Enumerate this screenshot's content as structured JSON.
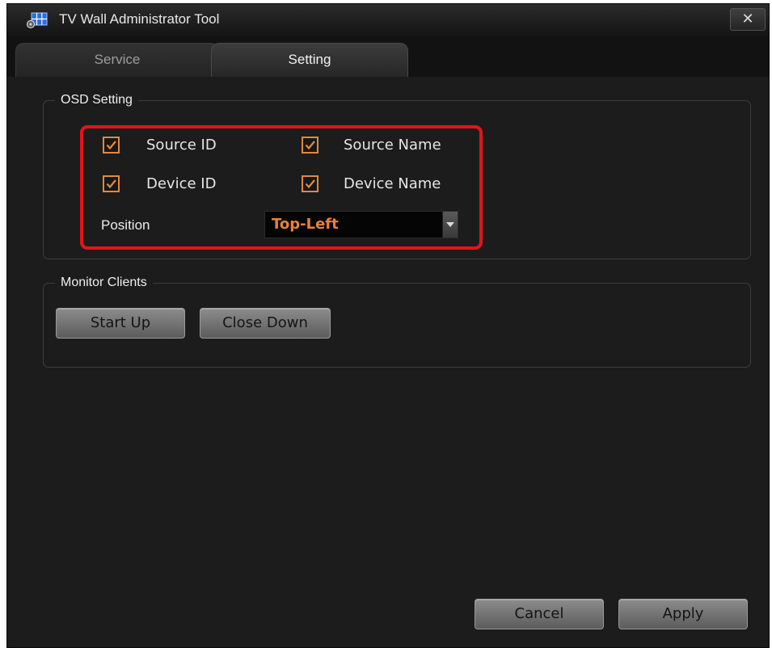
{
  "window": {
    "title": "TV Wall Administrator Tool",
    "close_glyph": "✕",
    "icon": "tv-wall-app-icon"
  },
  "tabs": [
    {
      "label": "Service",
      "active": false
    },
    {
      "label": "Setting",
      "active": true
    }
  ],
  "osd_setting": {
    "legend": "OSD Setting",
    "checkboxes": [
      {
        "label": "Source ID",
        "checked": true
      },
      {
        "label": "Source Name",
        "checked": true
      },
      {
        "label": "Device ID",
        "checked": true
      },
      {
        "label": "Device Name",
        "checked": true
      }
    ],
    "position_label": "Position",
    "position_value": "Top-Left"
  },
  "monitor_clients": {
    "legend": "Monitor Clients",
    "start_up_label": "Start Up",
    "close_down_label": "Close Down"
  },
  "footer": {
    "cancel_label": "Cancel",
    "apply_label": "Apply"
  },
  "colors": {
    "accent": "#e08a3e",
    "highlight": "#e3141c",
    "background": "#1c1c1c"
  }
}
